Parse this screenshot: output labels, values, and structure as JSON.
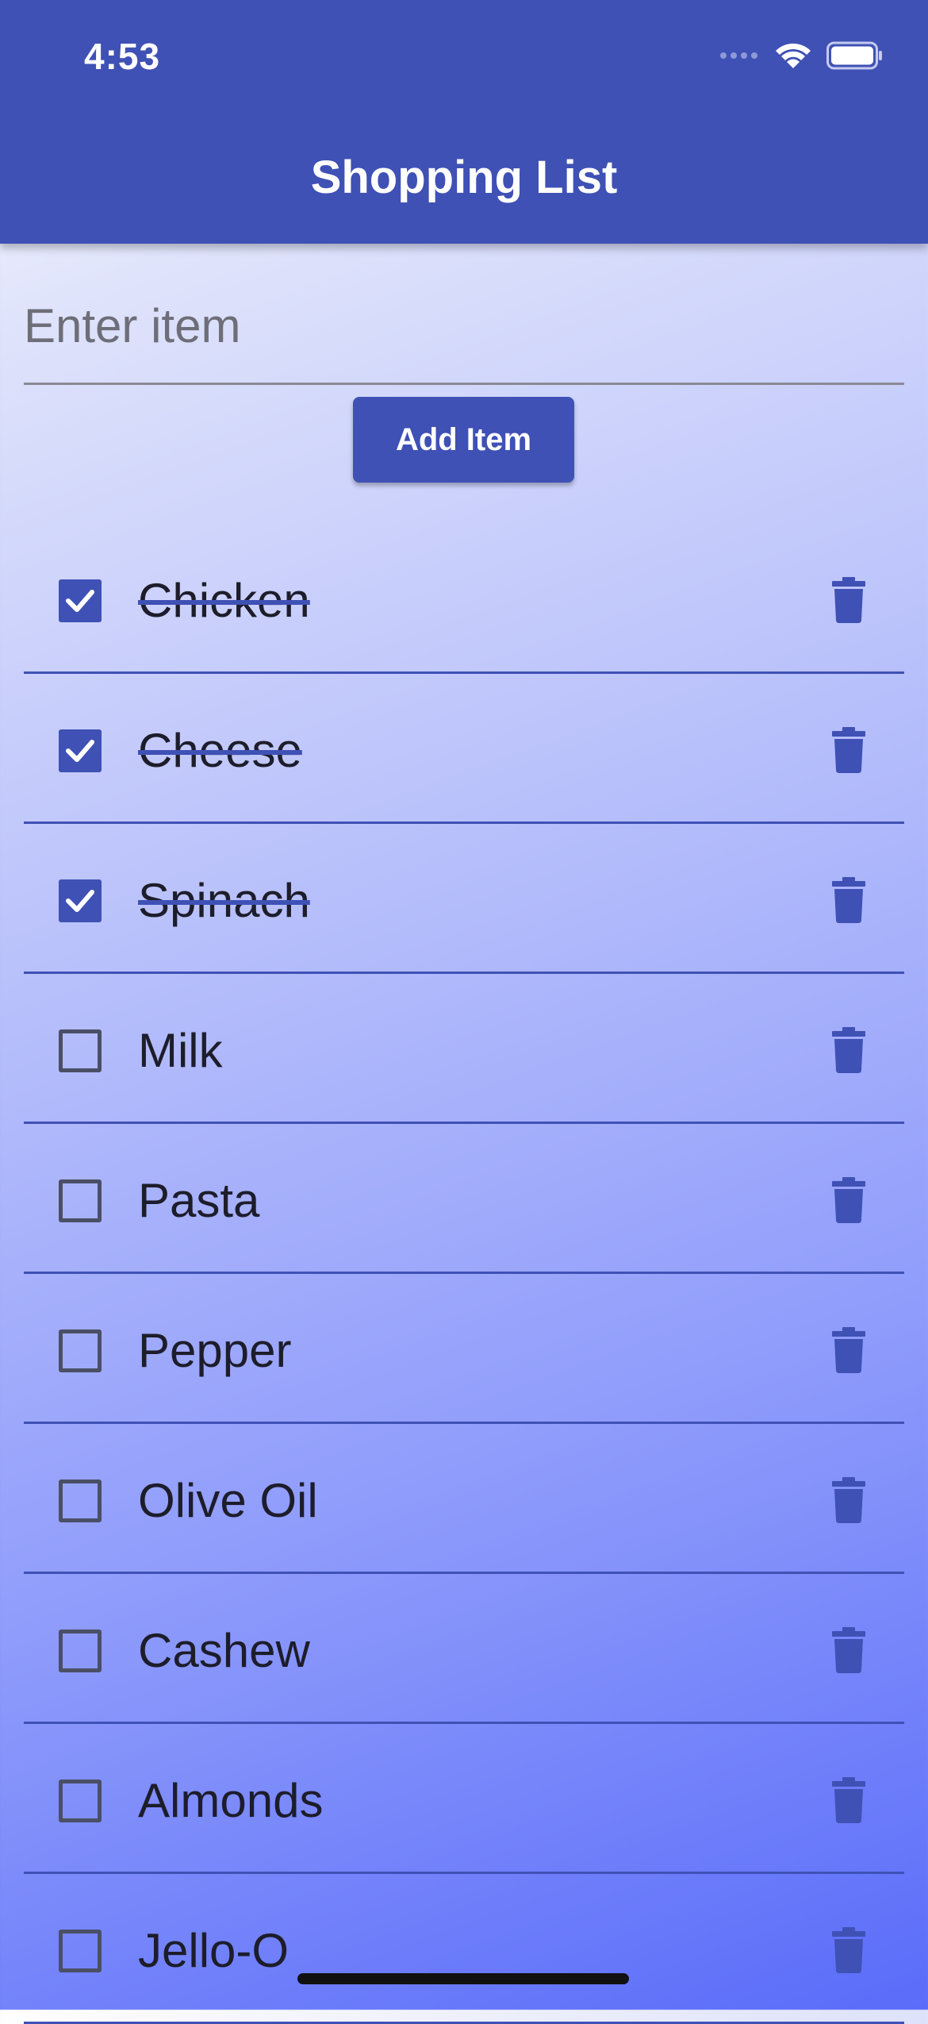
{
  "status_bar": {
    "time": "4:53",
    "icons": [
      "signal-icon",
      "wifi-icon",
      "battery-icon"
    ]
  },
  "header": {
    "title": "Shopping List"
  },
  "input": {
    "value": "",
    "placeholder": "Enter item"
  },
  "add_button": {
    "label": "Add Item"
  },
  "items": [
    {
      "label": "Chicken",
      "checked": true
    },
    {
      "label": "Cheese",
      "checked": true
    },
    {
      "label": "Spinach",
      "checked": true
    },
    {
      "label": "Milk",
      "checked": false
    },
    {
      "label": "Pasta",
      "checked": false
    },
    {
      "label": "Pepper",
      "checked": false
    },
    {
      "label": "Olive Oil",
      "checked": false
    },
    {
      "label": "Cashew",
      "checked": false
    },
    {
      "label": "Almonds",
      "checked": false
    },
    {
      "label": "Jello-O",
      "checked": false
    }
  ],
  "colors": {
    "primary": "#3f51b5",
    "text": "#1d1d2b",
    "checkbox_border": "#4a4f66"
  },
  "icons": {
    "checkbox_checked": "check-icon",
    "delete": "trash-icon"
  }
}
